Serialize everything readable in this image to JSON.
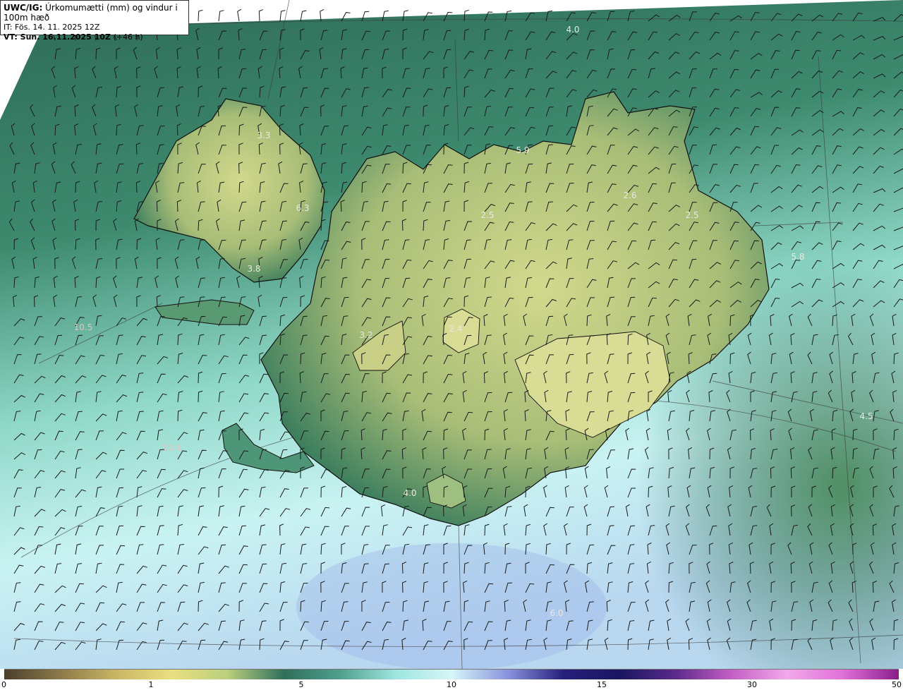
{
  "header": {
    "model_label": "UWC/IG:",
    "title": "Úrkomumætti (mm) og vindur i 100m hæð",
    "it_label": "IT:",
    "it_value": "Fös. 14. 11. 2025 12Z",
    "vt_label": "VT: Sun. 16.11.2025 10Z",
    "vt_offset": "(+46 h)"
  },
  "map_labels": [
    {
      "text": "4.0"
    },
    {
      "text": "3.3"
    },
    {
      "text": "5.9"
    },
    {
      "text": "2.6"
    },
    {
      "text": "6.3"
    },
    {
      "text": "2.5"
    },
    {
      "text": "2.5"
    },
    {
      "text": "5.8"
    },
    {
      "text": "3.8"
    },
    {
      "text": "10.5"
    },
    {
      "text": "3.2"
    },
    {
      "text": "2.4"
    },
    {
      "text": "4.5"
    },
    {
      "text": "10.4"
    },
    {
      "text": "4.0"
    },
    {
      "text": "6.0"
    }
  ],
  "colorbar": {
    "ticks": [
      "0",
      "1",
      "5",
      "10",
      "15",
      "30",
      "50"
    ],
    "colors": [
      "#4a3f2c",
      "#8c7a4a",
      "#c9b664",
      "#e9df80",
      "#b9cf7d",
      "#2f6f5b",
      "#4f9f8d",
      "#9fe5e0",
      "#d6f6f7",
      "#8a93dd",
      "#25207d",
      "#1a1660",
      "#5a2a8a",
      "#c45fc4",
      "#f2a9ea",
      "#e070d8",
      "#8a1c8a"
    ]
  },
  "colors": {
    "ocean_north": "#2f6b58",
    "ocean_south": "#c9f3f3",
    "land_low": "#3a7d5d",
    "land_high": "#d2d98c",
    "coastline": "#101010",
    "barb": "#1a1a1a"
  }
}
